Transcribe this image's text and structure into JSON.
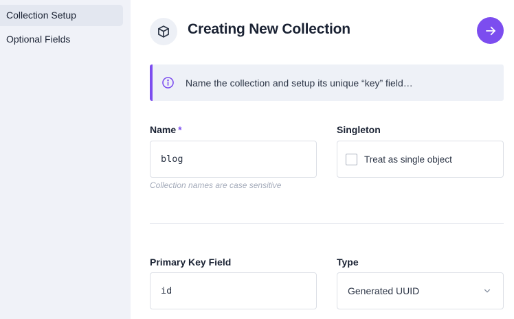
{
  "sidebar": {
    "items": [
      {
        "label": "Collection Setup",
        "active": true
      },
      {
        "label": "Optional Fields",
        "active": false
      }
    ]
  },
  "header": {
    "title": "Creating New Collection",
    "icon": "cube-icon",
    "next_icon": "arrow-right-icon"
  },
  "info": {
    "icon": "info-circle-icon",
    "text": "Name the collection and setup its unique “key” field…"
  },
  "form": {
    "name": {
      "label": "Name",
      "required_mark": "*",
      "value": "blog",
      "hint": "Collection names are case sensitive"
    },
    "singleton": {
      "label": "Singleton",
      "checkbox_label": "Treat as single object",
      "checked": false
    },
    "primary_key": {
      "label": "Primary Key Field",
      "value": "id"
    },
    "type": {
      "label": "Type",
      "selected": "Generated UUID",
      "icon": "chevron-down-icon"
    }
  },
  "colors": {
    "accent": "#7c4def",
    "sidebar_bg": "#f0f2f8",
    "sidebar_active": "#e3e7f0",
    "info_bg": "#eef1f7"
  }
}
